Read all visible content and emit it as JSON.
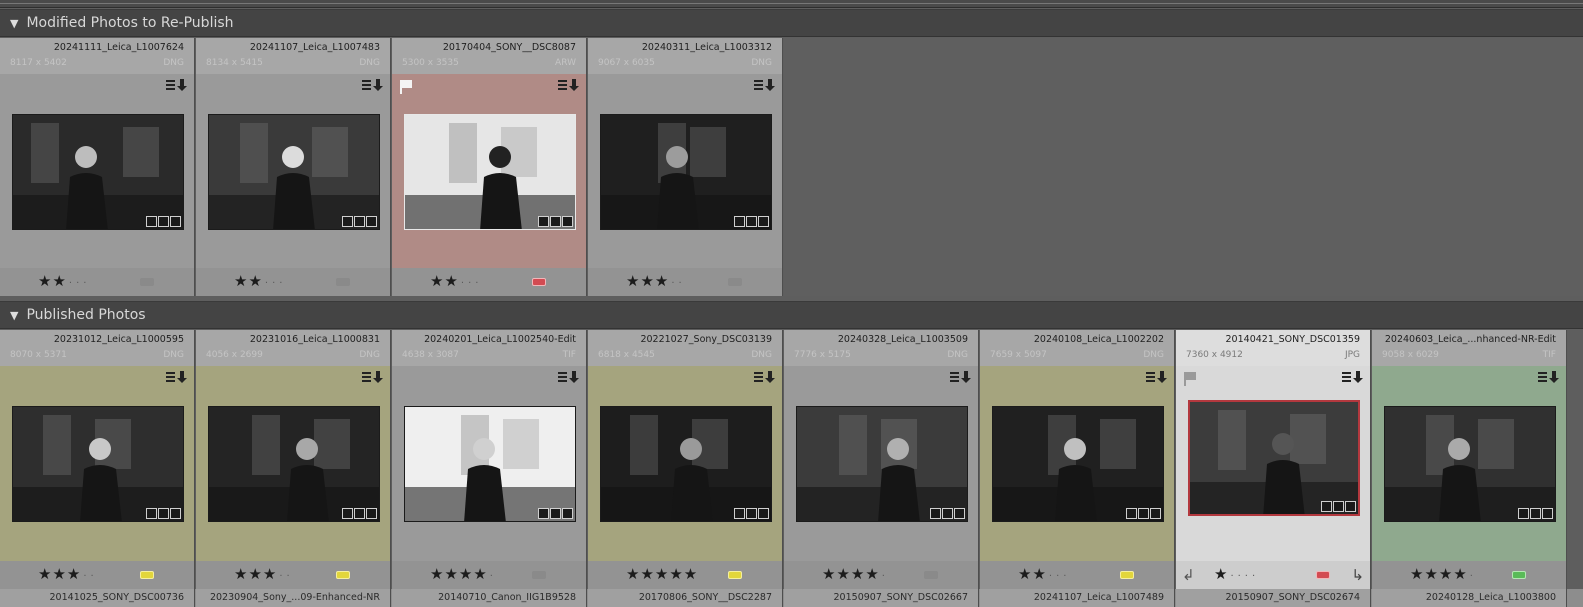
{
  "sections": {
    "modified": {
      "title": "Modified Photos to Re-Publish"
    },
    "published": {
      "title": "Published Photos"
    }
  },
  "icons": {
    "expand": "triangle-down-icon",
    "metadata": "metadata-badge-icon",
    "flag": "flag-icon"
  },
  "colors": {
    "red_label": "#d34b52",
    "yellow_label": "#e2d63b",
    "green_label": "#59bb58"
  },
  "modified_photos": [
    {
      "filename": "20241111_Leica_L1007624",
      "dims": "8117 x 5402",
      "ext": "DNG",
      "stars": "★★",
      "label": "none",
      "bg": "grey",
      "flag": false
    },
    {
      "filename": "20241107_Leica_L1007483",
      "dims": "8134 x 5415",
      "ext": "DNG",
      "stars": "★★",
      "label": "none",
      "bg": "grey",
      "flag": false
    },
    {
      "filename": "20170404_SONY__DSC8087",
      "dims": "5300 x 3535",
      "ext": "ARW",
      "stars": "★★",
      "label": "red",
      "bg": "red",
      "flag": true
    },
    {
      "filename": "20240311_Leica_L1003312",
      "dims": "9067 x 6035",
      "ext": "DNG",
      "stars": "★★★",
      "label": "none",
      "bg": "grey",
      "flag": false
    }
  ],
  "published_photos": [
    {
      "filename": "20231012_Leica_L1000595",
      "dims": "8070 x 5371",
      "ext": "DNG",
      "stars": "★★★",
      "label": "yellow",
      "bg": "yellow"
    },
    {
      "filename": "20231016_Leica_L1000831",
      "dims": "4056 x 2699",
      "ext": "DNG",
      "stars": "★★★",
      "label": "yellow",
      "bg": "yellow"
    },
    {
      "filename": "20240201_Leica_L1002540-Edit",
      "dims": "4638 x 3087",
      "ext": "TIF",
      "stars": "★★★★",
      "label": "none",
      "bg": "grey"
    },
    {
      "filename": "20221027_Sony_DSC03139",
      "dims": "6818 x 4545",
      "ext": "DNG",
      "stars": "★★★★★",
      "label": "yellow",
      "bg": "yellow"
    },
    {
      "filename": "20240328_Leica_L1003509",
      "dims": "7776 x 5175",
      "ext": "DNG",
      "stars": "★★★★",
      "label": "none",
      "bg": "grey"
    },
    {
      "filename": "20240108_Leica_L1002202",
      "dims": "7659 x 5097",
      "ext": "DNG",
      "stars": "★★",
      "label": "yellow",
      "bg": "yellow"
    },
    {
      "filename": "20140421_SONY_DSC01359",
      "dims": "7360 x 4912",
      "ext": "JPG",
      "stars": "★",
      "label": "red",
      "bg": "selected",
      "selected": true
    },
    {
      "filename": "20240603_Leica_...nhanced-NR-Edit",
      "dims": "9058 x 6029",
      "ext": "TIF",
      "stars": "★★★★",
      "label": "green",
      "bg": "green"
    }
  ],
  "next_row": [
    "20141025_SONY_DSC00736",
    "20230904_Sony_...09-Enhanced-NR",
    "20140710_Canon_IIG1B9528",
    "20170806_SONY__DSC2287",
    "20150907_SONY_DSC02667",
    "20241107_Leica_L1007489",
    "20150907_SONY_DSC02674",
    "20240128_Leica_L1003800"
  ]
}
